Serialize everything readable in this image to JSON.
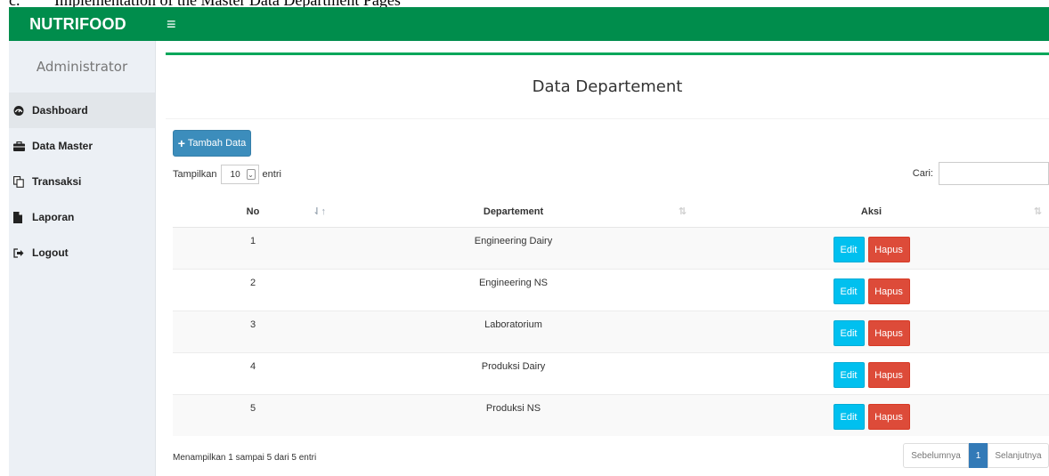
{
  "caption": {
    "number": "c.",
    "text": "Implementation of the Master Data Department Pages"
  },
  "app": {
    "brand": "NUTRIFOOD",
    "menu_icon": "≡"
  },
  "colors": {
    "header": "#008d4c",
    "accent": "#00a65a",
    "primary": "#3c8dbc",
    "info": "#00c0ef",
    "danger": "#dd4b39"
  },
  "sidebar": {
    "user": "Administrator",
    "items": [
      {
        "label": "Dashboard",
        "icon": "dashboard-icon"
      },
      {
        "label": "Data Master",
        "icon": "briefcase-icon"
      },
      {
        "label": "Transaksi",
        "icon": "copy-icon"
      },
      {
        "label": "Laporan",
        "icon": "file-icon"
      },
      {
        "label": "Logout",
        "icon": "sign-out-icon"
      }
    ]
  },
  "main": {
    "title": "Data Departement",
    "add_button": "Tambah Data",
    "length": {
      "prefix": "Tampilkan",
      "value": "10",
      "suffix": "entri"
    },
    "search_label": "Cari:",
    "table": {
      "columns": [
        "No",
        "Departement",
        "Aksi"
      ],
      "rows": [
        {
          "no": "1",
          "dept": "Engineering Dairy"
        },
        {
          "no": "2",
          "dept": "Engineering NS"
        },
        {
          "no": "3",
          "dept": "Laboratorium"
        },
        {
          "no": "4",
          "dept": "Produksi Dairy"
        },
        {
          "no": "5",
          "dept": "Produksi NS"
        }
      ],
      "edit_label": "Edit",
      "delete_label": "Hapus"
    },
    "info": "Menampilkan 1 sampai 5 dari 5 entri",
    "pagination": {
      "prev": "Sebelumnya",
      "current": "1",
      "next": "Selanjutnya"
    }
  }
}
